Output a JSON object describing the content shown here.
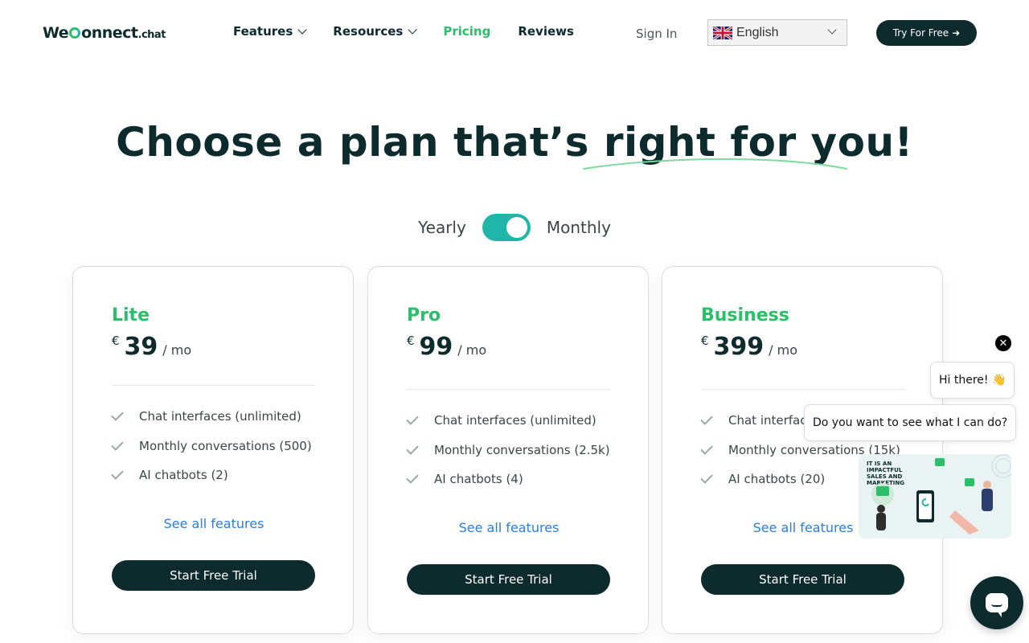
{
  "header": {
    "logo_we": "We",
    "logo_onnect": "onnect",
    "logo_chat": ".chat",
    "nav": [
      {
        "label": "Features",
        "dropdown": true
      },
      {
        "label": "Resources",
        "dropdown": true
      },
      {
        "label": "Pricing",
        "active": true
      },
      {
        "label": "Reviews"
      }
    ],
    "sign_in": "Sign In",
    "language": "English",
    "try_label": "Try For Free",
    "try_icon": "arrow-right-icon"
  },
  "hero": {
    "title_plain": "Choose a plan that’s ",
    "title_highlight": "right for you!"
  },
  "billing": {
    "yearly": "Yearly",
    "monthly": "Monthly",
    "selected": "Monthly"
  },
  "plans": [
    {
      "name": "Lite",
      "currency": "€",
      "amount": "39",
      "per": "/ mo",
      "features": [
        "Chat interfaces (unlimited)",
        "Monthly conversations (500)",
        "AI chatbots (2)"
      ],
      "see_all": "See all features",
      "cta": "Start Free Trial"
    },
    {
      "name": "Pro",
      "currency": "€",
      "amount": "99",
      "per": "/ mo",
      "features": [
        "Chat interfaces (unlimited)",
        "Monthly conversations (2.5k)",
        "AI chatbots (4)"
      ],
      "see_all": "See all features",
      "cta": "Start Free Trial"
    },
    {
      "name": "Business",
      "currency": "€",
      "amount": "399",
      "per": "/ mo",
      "features": [
        "Chat interfaces (unlimited)",
        "Monthly conversations (15k)",
        "AI chatbots (20)"
      ],
      "see_all": "See all features",
      "cta": "Start Free Trial"
    }
  ],
  "chat_widget": {
    "greeting": "Hi there! 👋",
    "question": "Do you want to see what I can do?",
    "promo_text": "IT IS AN IMPACTFUL SALES AND MARKETING",
    "close_icon": "close-icon",
    "launcher_icon": "chat-bubble-icon"
  },
  "colors": {
    "brand_dark": "#0d2a2c",
    "brand_green": "#2bbf6a",
    "toggle_teal": "#1fb5a8",
    "link_blue": "#2b7fd6"
  }
}
